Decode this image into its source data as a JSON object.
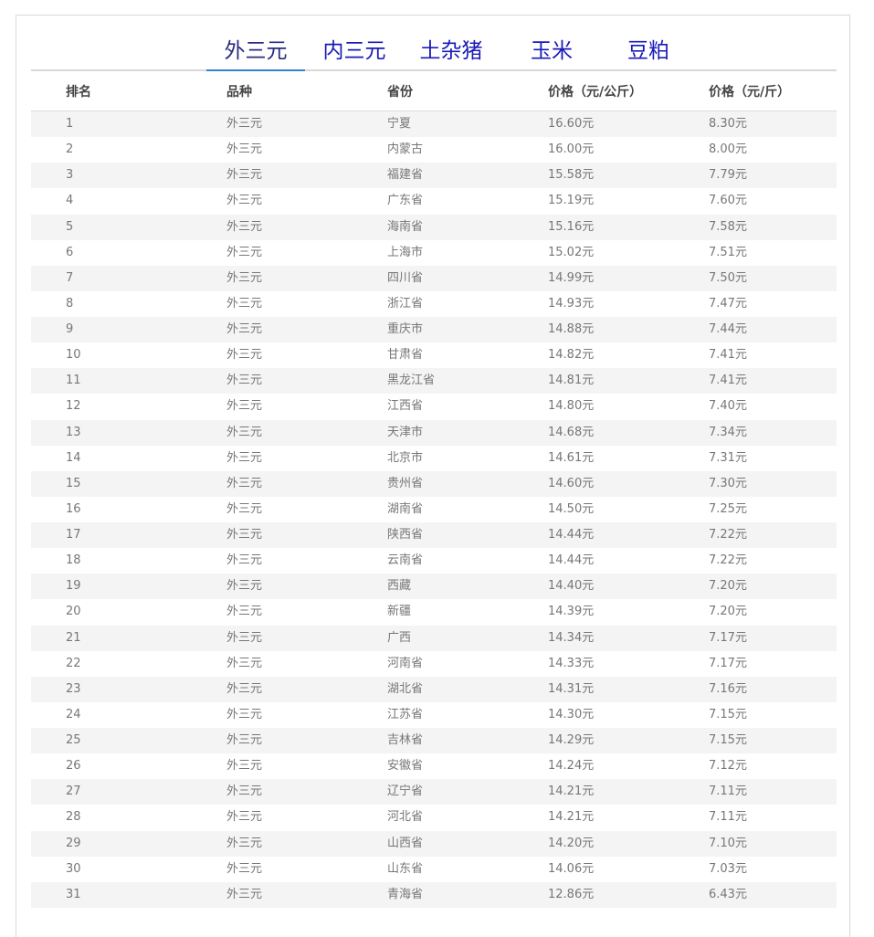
{
  "tabs": [
    {
      "label": "外三元",
      "active": true
    },
    {
      "label": "内三元",
      "active": false
    },
    {
      "label": "土杂猪",
      "active": false
    },
    {
      "label": "玉米",
      "active": false
    },
    {
      "label": "豆粕",
      "active": false
    }
  ],
  "table": {
    "columns": [
      "排名",
      "品种",
      "省份",
      "价格（元/公斤）",
      "价格（元/斤）"
    ],
    "rows": [
      [
        "1",
        "外三元",
        "宁夏",
        "16.60元",
        "8.30元"
      ],
      [
        "2",
        "外三元",
        "内蒙古",
        "16.00元",
        "8.00元"
      ],
      [
        "3",
        "外三元",
        "福建省",
        "15.58元",
        "7.79元"
      ],
      [
        "4",
        "外三元",
        "广东省",
        "15.19元",
        "7.60元"
      ],
      [
        "5",
        "外三元",
        "海南省",
        "15.16元",
        "7.58元"
      ],
      [
        "6",
        "外三元",
        "上海市",
        "15.02元",
        "7.51元"
      ],
      [
        "7",
        "外三元",
        "四川省",
        "14.99元",
        "7.50元"
      ],
      [
        "8",
        "外三元",
        "浙江省",
        "14.93元",
        "7.47元"
      ],
      [
        "9",
        "外三元",
        "重庆市",
        "14.88元",
        "7.44元"
      ],
      [
        "10",
        "外三元",
        "甘肃省",
        "14.82元",
        "7.41元"
      ],
      [
        "11",
        "外三元",
        "黑龙江省",
        "14.81元",
        "7.41元"
      ],
      [
        "12",
        "外三元",
        "江西省",
        "14.80元",
        "7.40元"
      ],
      [
        "13",
        "外三元",
        "天津市",
        "14.68元",
        "7.34元"
      ],
      [
        "14",
        "外三元",
        "北京市",
        "14.61元",
        "7.31元"
      ],
      [
        "15",
        "外三元",
        "贵州省",
        "14.60元",
        "7.30元"
      ],
      [
        "16",
        "外三元",
        "湖南省",
        "14.50元",
        "7.25元"
      ],
      [
        "17",
        "外三元",
        "陕西省",
        "14.44元",
        "7.22元"
      ],
      [
        "18",
        "外三元",
        "云南省",
        "14.44元",
        "7.22元"
      ],
      [
        "19",
        "外三元",
        "西藏",
        "14.40元",
        "7.20元"
      ],
      [
        "20",
        "外三元",
        "新疆",
        "14.39元",
        "7.20元"
      ],
      [
        "21",
        "外三元",
        "广西",
        "14.34元",
        "7.17元"
      ],
      [
        "22",
        "外三元",
        "河南省",
        "14.33元",
        "7.17元"
      ],
      [
        "23",
        "外三元",
        "湖北省",
        "14.31元",
        "7.16元"
      ],
      [
        "24",
        "外三元",
        "江苏省",
        "14.30元",
        "7.15元"
      ],
      [
        "25",
        "外三元",
        "吉林省",
        "14.29元",
        "7.15元"
      ],
      [
        "26",
        "外三元",
        "安徽省",
        "14.24元",
        "7.12元"
      ],
      [
        "27",
        "外三元",
        "辽宁省",
        "14.21元",
        "7.11元"
      ],
      [
        "28",
        "外三元",
        "河北省",
        "14.21元",
        "7.11元"
      ],
      [
        "29",
        "外三元",
        "山西省",
        "14.20元",
        "7.10元"
      ],
      [
        "30",
        "外三元",
        "山东省",
        "14.06元",
        "7.03元"
      ],
      [
        "31",
        "外三元",
        "青海省",
        "12.86元",
        "6.43元"
      ]
    ]
  }
}
